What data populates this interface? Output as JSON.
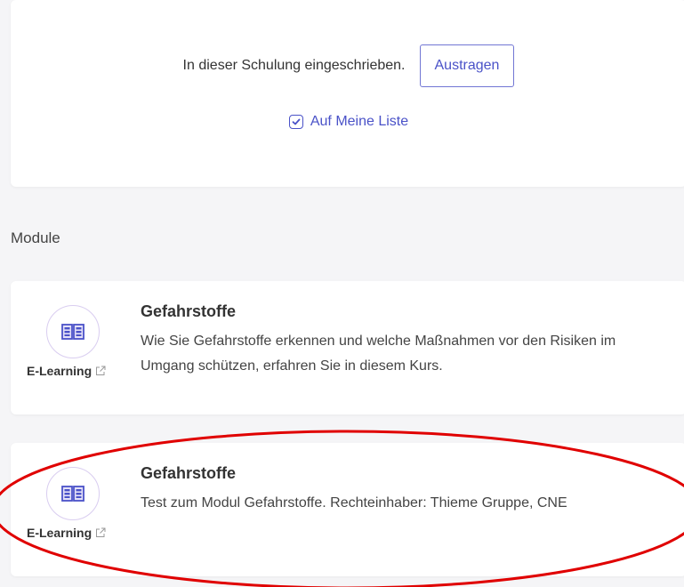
{
  "enrollment": {
    "status_text": "In dieser Schulung eingeschrieben.",
    "unenroll_label": "Austragen",
    "mylist_label": "Auf Meine Liste"
  },
  "modules_section": {
    "title": "Module",
    "items": [
      {
        "title": "Gefahrstoffe",
        "description": "Wie Sie Gefahrstoffe erkennen und welche Maßnahmen vor den Risiken im Umgang schützen, erfahren Sie in diesem Kurs.",
        "type": "E-Learning",
        "icon": "book-icon"
      },
      {
        "title": "Gefahrstoffe",
        "description": "Test zum Modul Gefahrstoffe. Rechteinhaber: Thieme Gruppe, CNE",
        "type": "E-Learning",
        "icon": "book-icon"
      }
    ]
  },
  "colors": {
    "accent": "#4a52c8",
    "annotation": "#e00000",
    "icon_ring": "#d9cdf0"
  }
}
